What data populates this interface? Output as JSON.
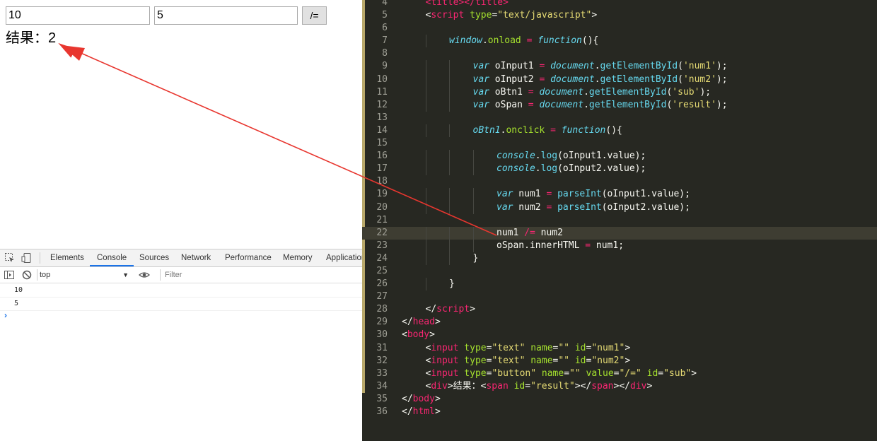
{
  "browser": {
    "input1_value": "10",
    "input2_value": "5",
    "button_label": "/=",
    "result_text": "结果：2"
  },
  "devtools": {
    "tabs": [
      "Elements",
      "Console",
      "Sources",
      "Network",
      "Performance",
      "Memory",
      "Application"
    ],
    "active_tab": "Console",
    "context": "top",
    "filter_placeholder": "Filter",
    "logs": [
      "10",
      "5"
    ],
    "prompt": "›",
    "accent_color": "#1a73e8"
  },
  "editor": {
    "theme": {
      "background": "#272822",
      "tag": "#f92672",
      "attr": "#a6e22e",
      "string": "#e6db74",
      "keyword": "#66d9ef"
    },
    "highlighted_line": "22",
    "lines": [
      {
        "n": "4",
        "i": 1,
        "t": [
          [
            "tag",
            "<"
          ],
          [
            "tag",
            "title"
          ],
          [
            "tag",
            ">"
          ],
          [
            "tag",
            "</"
          ],
          [
            "tag",
            "title"
          ],
          [
            "tag",
            ">"
          ]
        ]
      },
      {
        "n": "5",
        "i": 1,
        "t": [
          [
            "pl",
            "<"
          ],
          [
            "tag",
            "script"
          ],
          [
            "pl",
            " "
          ],
          [
            "attr",
            "type"
          ],
          [
            "pl",
            "="
          ],
          [
            "str",
            "\"text/javascript\""
          ],
          [
            "pl",
            ">"
          ]
        ]
      },
      {
        "n": "6",
        "i": 0,
        "t": []
      },
      {
        "n": "7",
        "i": 2,
        "t": [
          [
            "kw",
            "window"
          ],
          [
            "pl",
            "."
          ],
          [
            "attr",
            "onload"
          ],
          [
            "pl",
            " "
          ],
          [
            "op",
            "="
          ],
          [
            "pl",
            " "
          ],
          [
            "kw",
            "function"
          ],
          [
            "pl",
            "(){"
          ]
        ]
      },
      {
        "n": "8",
        "i": 0,
        "t": []
      },
      {
        "n": "9",
        "i": 3,
        "t": [
          [
            "kw",
            "var"
          ],
          [
            "pl",
            " oInput1 "
          ],
          [
            "op",
            "="
          ],
          [
            "pl",
            " "
          ],
          [
            "kw",
            "document"
          ],
          [
            "pl",
            "."
          ],
          [
            "fn",
            "getElementById"
          ],
          [
            "pl",
            "("
          ],
          [
            "str",
            "'num1'"
          ],
          [
            "pl",
            ");"
          ]
        ]
      },
      {
        "n": "10",
        "i": 3,
        "t": [
          [
            "kw",
            "var"
          ],
          [
            "pl",
            " oInput2 "
          ],
          [
            "op",
            "="
          ],
          [
            "pl",
            " "
          ],
          [
            "kw",
            "document"
          ],
          [
            "pl",
            "."
          ],
          [
            "fn",
            "getElementById"
          ],
          [
            "pl",
            "("
          ],
          [
            "str",
            "'num2'"
          ],
          [
            "pl",
            ");"
          ]
        ]
      },
      {
        "n": "11",
        "i": 3,
        "t": [
          [
            "kw",
            "var"
          ],
          [
            "pl",
            " oBtn1 "
          ],
          [
            "op",
            "="
          ],
          [
            "pl",
            " "
          ],
          [
            "kw",
            "document"
          ],
          [
            "pl",
            "."
          ],
          [
            "fn",
            "getElementById"
          ],
          [
            "pl",
            "("
          ],
          [
            "str",
            "'sub'"
          ],
          [
            "pl",
            ");"
          ]
        ]
      },
      {
        "n": "12",
        "i": 3,
        "t": [
          [
            "kw",
            "var"
          ],
          [
            "pl",
            " oSpan "
          ],
          [
            "op",
            "="
          ],
          [
            "pl",
            " "
          ],
          [
            "kw",
            "document"
          ],
          [
            "pl",
            "."
          ],
          [
            "fn",
            "getElementById"
          ],
          [
            "pl",
            "("
          ],
          [
            "str",
            "'result'"
          ],
          [
            "pl",
            ");"
          ]
        ]
      },
      {
        "n": "13",
        "i": 0,
        "t": []
      },
      {
        "n": "14",
        "i": 3,
        "t": [
          [
            "kw",
            "oBtn1"
          ],
          [
            "pl",
            "."
          ],
          [
            "attr",
            "onclick"
          ],
          [
            "pl",
            " "
          ],
          [
            "op",
            "="
          ],
          [
            "pl",
            " "
          ],
          [
            "kw",
            "function"
          ],
          [
            "pl",
            "(){"
          ]
        ]
      },
      {
        "n": "15",
        "i": 0,
        "t": []
      },
      {
        "n": "16",
        "i": 4,
        "t": [
          [
            "kw",
            "console"
          ],
          [
            "pl",
            "."
          ],
          [
            "fn",
            "log"
          ],
          [
            "pl",
            "(oInput1.value);"
          ]
        ]
      },
      {
        "n": "17",
        "i": 4,
        "t": [
          [
            "kw",
            "console"
          ],
          [
            "pl",
            "."
          ],
          [
            "fn",
            "log"
          ],
          [
            "pl",
            "(oInput2.value);"
          ]
        ]
      },
      {
        "n": "18",
        "i": 0,
        "t": []
      },
      {
        "n": "19",
        "i": 4,
        "t": [
          [
            "kw",
            "var"
          ],
          [
            "pl",
            " num1 "
          ],
          [
            "op",
            "="
          ],
          [
            "pl",
            " "
          ],
          [
            "fn",
            "parseInt"
          ],
          [
            "pl",
            "(oInput1.value);"
          ]
        ]
      },
      {
        "n": "20",
        "i": 4,
        "t": [
          [
            "kw",
            "var"
          ],
          [
            "pl",
            " num2 "
          ],
          [
            "op",
            "="
          ],
          [
            "pl",
            " "
          ],
          [
            "fn",
            "parseInt"
          ],
          [
            "pl",
            "(oInput2.value);"
          ]
        ]
      },
      {
        "n": "21",
        "i": 0,
        "t": []
      },
      {
        "n": "22",
        "i": 4,
        "t": [
          [
            "pl",
            "num1 "
          ],
          [
            "op",
            "/="
          ],
          [
            "pl",
            " num2"
          ]
        ]
      },
      {
        "n": "23",
        "i": 4,
        "t": [
          [
            "pl",
            "oSpan.innerHTML "
          ],
          [
            "op",
            "="
          ],
          [
            "pl",
            " num1;"
          ]
        ]
      },
      {
        "n": "24",
        "i": 3,
        "t": [
          [
            "pl",
            "}"
          ]
        ]
      },
      {
        "n": "25",
        "i": 0,
        "t": []
      },
      {
        "n": "26",
        "i": 2,
        "t": [
          [
            "pl",
            "}"
          ]
        ]
      },
      {
        "n": "27",
        "i": 0,
        "t": []
      },
      {
        "n": "28",
        "i": 1,
        "t": [
          [
            "pl",
            "</"
          ],
          [
            "tag",
            "script"
          ],
          [
            "pl",
            ">"
          ]
        ]
      },
      {
        "n": "29",
        "i": 0,
        "t": [
          [
            "pl",
            "</"
          ],
          [
            "tag",
            "head"
          ],
          [
            "pl",
            ">"
          ]
        ]
      },
      {
        "n": "30",
        "i": 0,
        "t": [
          [
            "pl",
            "<"
          ],
          [
            "tag",
            "body"
          ],
          [
            "pl",
            ">"
          ]
        ]
      },
      {
        "n": "31",
        "i": 1,
        "t": [
          [
            "pl",
            "<"
          ],
          [
            "tag",
            "input"
          ],
          [
            "pl",
            " "
          ],
          [
            "attr",
            "type"
          ],
          [
            "pl",
            "="
          ],
          [
            "str",
            "\"text\""
          ],
          [
            "pl",
            " "
          ],
          [
            "attr",
            "name"
          ],
          [
            "pl",
            "="
          ],
          [
            "str",
            "\"\""
          ],
          [
            "pl",
            " "
          ],
          [
            "attr",
            "id"
          ],
          [
            "pl",
            "="
          ],
          [
            "str",
            "\"num1\""
          ],
          [
            "pl",
            ">"
          ]
        ]
      },
      {
        "n": "32",
        "i": 1,
        "t": [
          [
            "pl",
            "<"
          ],
          [
            "tag",
            "input"
          ],
          [
            "pl",
            " "
          ],
          [
            "attr",
            "type"
          ],
          [
            "pl",
            "="
          ],
          [
            "str",
            "\"text\""
          ],
          [
            "pl",
            " "
          ],
          [
            "attr",
            "name"
          ],
          [
            "pl",
            "="
          ],
          [
            "str",
            "\"\""
          ],
          [
            "pl",
            " "
          ],
          [
            "attr",
            "id"
          ],
          [
            "pl",
            "="
          ],
          [
            "str",
            "\"num2\""
          ],
          [
            "pl",
            ">"
          ]
        ]
      },
      {
        "n": "33",
        "i": 1,
        "t": [
          [
            "pl",
            "<"
          ],
          [
            "tag",
            "input"
          ],
          [
            "pl",
            " "
          ],
          [
            "attr",
            "type"
          ],
          [
            "pl",
            "="
          ],
          [
            "str",
            "\"button\""
          ],
          [
            "pl",
            " "
          ],
          [
            "attr",
            "name"
          ],
          [
            "pl",
            "="
          ],
          [
            "str",
            "\"\""
          ],
          [
            "pl",
            " "
          ],
          [
            "attr",
            "value"
          ],
          [
            "pl",
            "="
          ],
          [
            "str",
            "\"/=\""
          ],
          [
            "pl",
            " "
          ],
          [
            "attr",
            "id"
          ],
          [
            "pl",
            "="
          ],
          [
            "str",
            "\"sub\""
          ],
          [
            "pl",
            ">"
          ]
        ]
      },
      {
        "n": "34",
        "i": 1,
        "t": [
          [
            "pl",
            "<"
          ],
          [
            "tag",
            "div"
          ],
          [
            "pl",
            ">结果："
          ],
          [
            "pl",
            "<"
          ],
          [
            "tag",
            "span"
          ],
          [
            "pl",
            " "
          ],
          [
            "attr",
            "id"
          ],
          [
            "pl",
            "="
          ],
          [
            "str",
            "\"result\""
          ],
          [
            "pl",
            ">"
          ],
          [
            "pl",
            "</"
          ],
          [
            "tag",
            "span"
          ],
          [
            "pl",
            ">"
          ],
          [
            "pl",
            "</"
          ],
          [
            "tag",
            "div"
          ],
          [
            "pl",
            ">"
          ]
        ]
      },
      {
        "n": "35",
        "i": 0,
        "t": [
          [
            "pl",
            "</"
          ],
          [
            "tag",
            "body"
          ],
          [
            "pl",
            ">"
          ]
        ]
      },
      {
        "n": "36",
        "i": 0,
        "t": [
          [
            "pl",
            "</"
          ],
          [
            "tag",
            "html"
          ],
          [
            "pl",
            ">"
          ]
        ]
      }
    ]
  },
  "annotation": {
    "arrow_color": "#e8362f"
  }
}
